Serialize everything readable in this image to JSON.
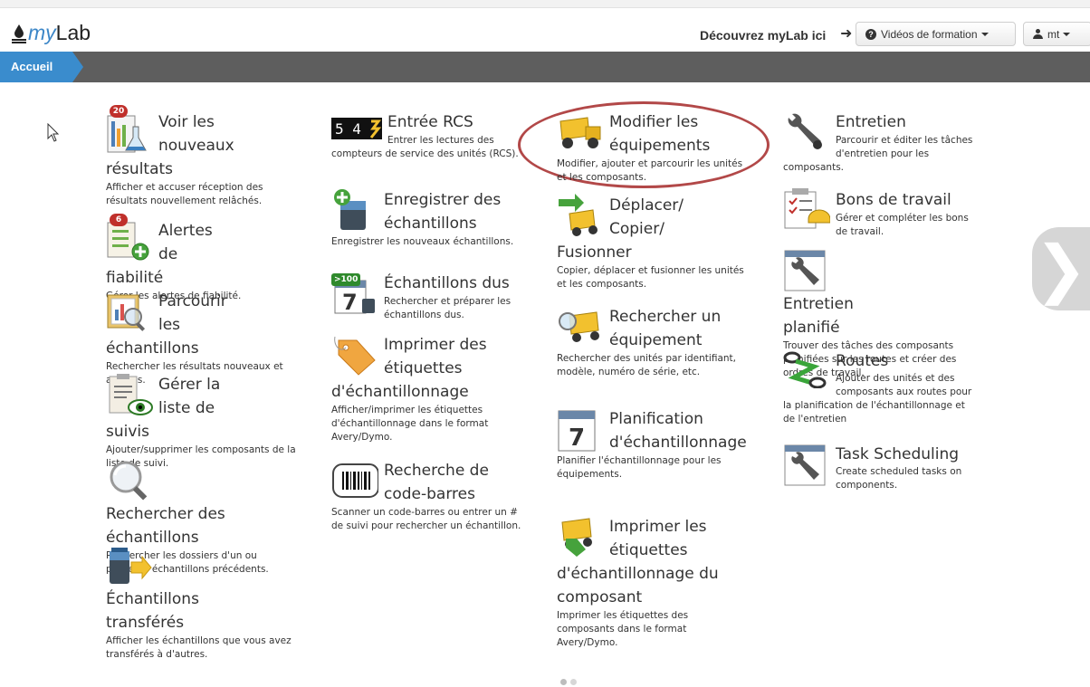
{
  "header": {
    "logo_my": "my",
    "logo_lab": "Lab",
    "discover": "Découvrez myLab ici",
    "videos": "Vidéos de formation",
    "user": "mt"
  },
  "nav": {
    "home": "Accueil"
  },
  "col1": [
    {
      "title": "Voir les nouveaux résultats",
      "desc": "Afficher et accuser réception des résultats nouvellement relâchés.",
      "badge": "20",
      "icon": "results-flask-icon"
    },
    {
      "title": "Alertes de fiabilité",
      "desc": "Gérer les alertes de fiabilité.",
      "badge": "6",
      "icon": "reliability-alert-icon"
    },
    {
      "title": "Parcourir les échantillons",
      "desc": "Rechercher les résultats nouveaux et anciens.",
      "icon": "browse-samples-icon"
    },
    {
      "title": "Gérer la liste de suivis",
      "desc": "Ajouter/supprimer les composants de la liste de suivi.",
      "icon": "watchlist-eye-icon"
    },
    {
      "title": "Rechercher des échantillons",
      "desc": "Rechercher les dossiers d'un ou plusieurs échantillons précédents.",
      "icon": "magnifier-icon"
    },
    {
      "title": "Échantillons transférés",
      "desc": "Afficher les échantillons que vous avez transférés à d'autres.",
      "icon": "transfer-bottle-icon"
    }
  ],
  "col2": [
    {
      "title": "Entrée RCS",
      "desc": "Entrer les lectures des compteurs de service des unités (RCS).",
      "icon": "counter-digits-icon",
      "digits": "5 4"
    },
    {
      "title": "Enregistrer des échantillons",
      "desc": "Enregistrer les nouveaux échantillons.",
      "icon": "register-bottle-icon"
    },
    {
      "title": "Échantillons dus",
      "desc": "Rechercher et préparer les échantillons dus.",
      "badge": ">100",
      "icon": "calendar-due-icon",
      "day": "7"
    },
    {
      "title": "Imprimer des étiquettes d'échantillonnage",
      "desc": "Afficher/imprimer les étiquettes d'échantillonnage dans le format Avery/Dymo.",
      "icon": "tag-label-icon"
    },
    {
      "title": "Recherche de code-barres",
      "desc": "Scanner un code-barres ou entrer un # de suivi pour rechercher un échantillon.",
      "icon": "barcode-icon"
    }
  ],
  "col3": [
    {
      "title": "Modifier les équipements",
      "desc": "Modifier, ajouter et parcourir les unités et les composants.",
      "icon": "dump-truck-icon"
    },
    {
      "title": "Déplacer/ Copier/ Fusionner",
      "desc": "Copier, déplacer et fusionner les unités et les composants.",
      "icon": "move-truck-icon"
    },
    {
      "title": "Rechercher un équipement",
      "desc": "Rechercher des unités par identifiant, modèle, numéro de série, etc.",
      "icon": "search-truck-icon"
    },
    {
      "title": "Planification d'échantillonnage",
      "desc": "Planifier l'échantillonnage pour les équipements.",
      "icon": "calendar-icon",
      "day": "7"
    },
    {
      "title": "Imprimer les étiquettes d'échantillonnage du composant",
      "desc": "Imprimer les étiquettes des composants dans le format Avery/Dymo.",
      "icon": "truck-tag-icon"
    }
  ],
  "col4": [
    {
      "title": "Entretien",
      "desc": "Parcourir et éditer les tâches d'entretien pour les composants.",
      "icon": "wrench-icon"
    },
    {
      "title": "Bons de travail",
      "desc": "Gérer et compléter les bons de travail.",
      "icon": "work-order-icon"
    },
    {
      "title": "Entretien planifié",
      "desc": "Trouver des tâches des composants planifiées sur les routes et créer des ordres de travail.",
      "icon": "scheduled-wrench-icon"
    },
    {
      "title": "Routes",
      "desc": "Ajouter des unités et des composants aux routes pour la planification de l'échantillonnage et de l'entretien",
      "icon": "route-icon"
    },
    {
      "title": "Task Scheduling",
      "desc": "Create scheduled tasks on components.",
      "icon": "task-schedule-icon"
    }
  ],
  "next_arrow": "❯"
}
